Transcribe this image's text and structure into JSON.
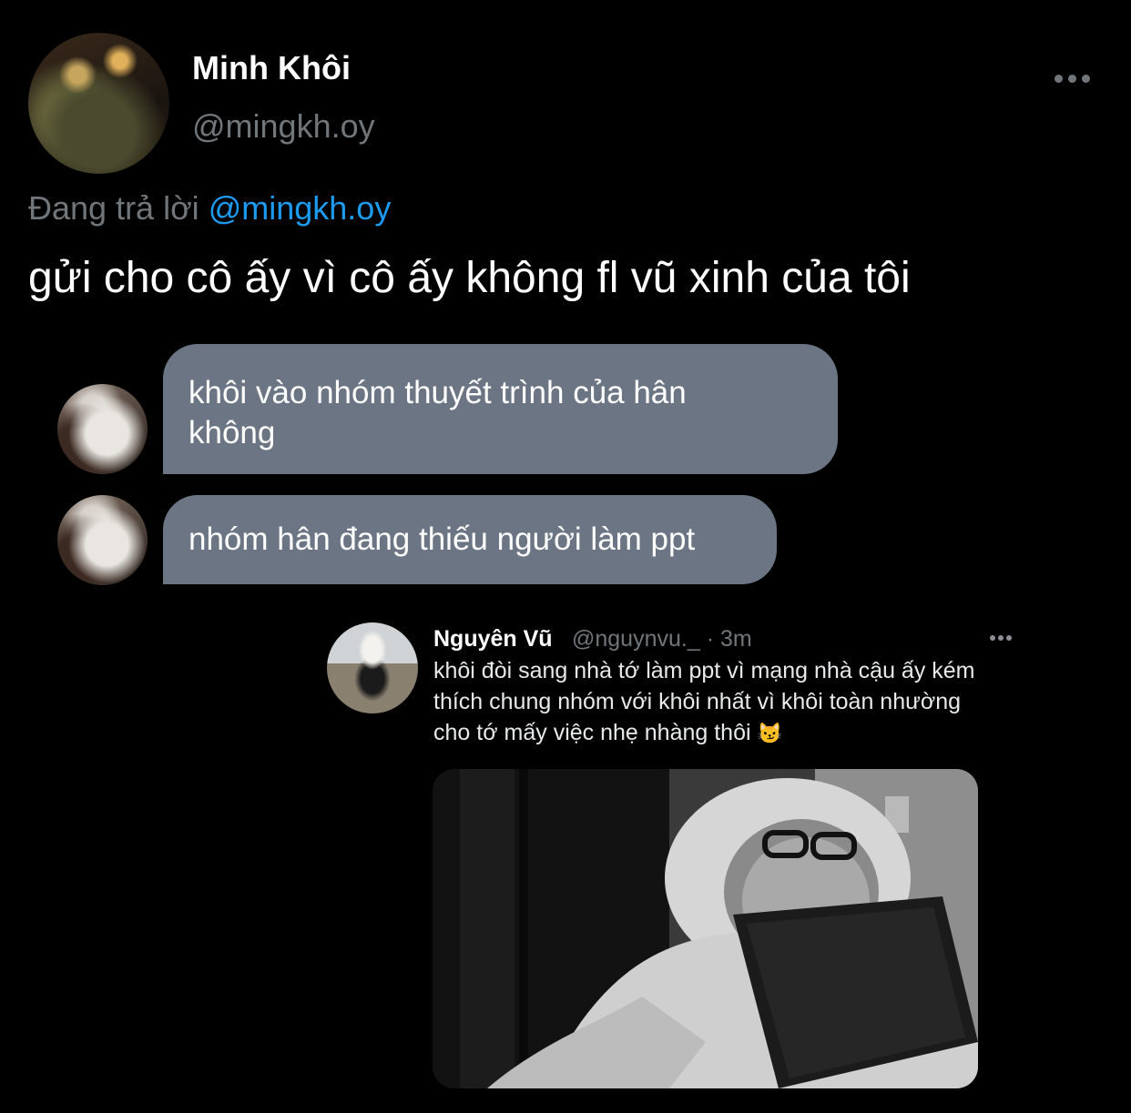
{
  "tweet": {
    "author_name": "Minh Khôi",
    "author_handle": "@mingkh.oy",
    "reply_prefix": "Đang trả lời",
    "reply_mention": "@mingkh.oy",
    "text": "gửi cho cô ấy vì cô ấy không fl vũ xinh của tôi"
  },
  "messages": [
    {
      "text_line1": "khôi vào nhóm thuyết trình của hân",
      "text_line2": "không"
    },
    {
      "text_line1": "nhóm hân đang thiếu người làm ppt"
    }
  ],
  "quoted_tweet": {
    "author_name": "Nguyên Vũ",
    "meta": "@nguynvu._ · 3m",
    "line1": "khôi đòi sang nhà tớ làm ppt vì mạng nhà cậu ấy kém",
    "line2": "thích chung nhóm với khôi nhất vì khôi toàn nhường",
    "line3": "cho tớ mấy việc nhẹ nhàng thôi",
    "emoji": "😼"
  },
  "colors": {
    "background": "#000000",
    "bubble": "#6b7583",
    "mention": "#1d9bf0",
    "muted": "#71767b"
  }
}
